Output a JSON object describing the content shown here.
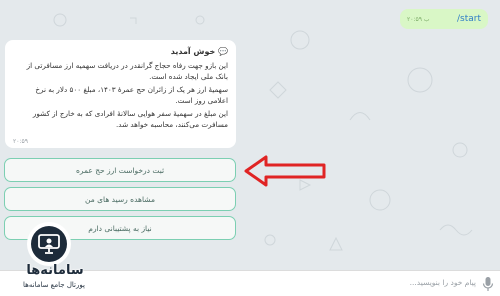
{
  "chat": {
    "user_message": {
      "text": "/start",
      "time": "ب ۲۰:۵۹"
    },
    "bot_message": {
      "welcome": "💬 خوش آمدید",
      "paragraph1": "این بازو جهت رفاه حجاج گرانقدر در دریافت سهمیه ارز مسافرتی از بانک ملی ایجاد شده است.",
      "paragraph2": "سهمیهٔ ارز هر یک از زائران حج عمرهٔ ۱۴۰۳، مبلغ ۵۰۰ دلار به نرخ اعلامی روز است.",
      "paragraph3": "این مبلغ در سهمیهٔ سفر هوایی سالانهٔ افرادی که به خارج از کشور مسافرت می‌کنند، محاسبه خواهد شد.",
      "time": "۲۰:۵۹"
    }
  },
  "keyboard": {
    "buttons": [
      {
        "label": "ثبت درخواست ارز حج عمره"
      },
      {
        "label": "مشاهده رسید های من"
      },
      {
        "label": "نیاز به پشتیبانی دارم"
      }
    ]
  },
  "input": {
    "placeholder": "پیام خود را بنویسید..."
  },
  "watermark": {
    "name": "سامانه‌ها",
    "subtitle": "پورتال جامع سامانه‌ها"
  },
  "colors": {
    "accent_arrow": "#e02424",
    "button_border": "#7ccfb2",
    "user_bubble": "#d9f7c6"
  },
  "icons": {
    "mic": "mic-icon",
    "arrow": "left-arrow-icon",
    "logo": "monitor-person-icon"
  }
}
